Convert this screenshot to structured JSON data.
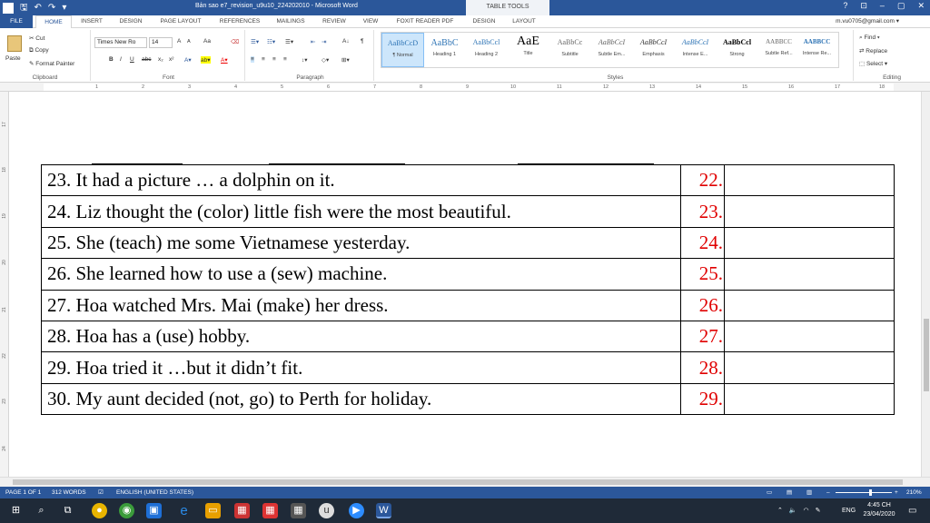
{
  "window": {
    "title": "Bản sao e7_revision_u9u10_224202010 - Microsoft Word",
    "table_tools": "TABLE TOOLS",
    "controls": [
      "?",
      "⊡",
      "–",
      "▢",
      "✕"
    ]
  },
  "tabs": {
    "file": "FILE",
    "home": "HOME",
    "insert": "INSERT",
    "design": "DESIGN",
    "page_layout": "PAGE LAYOUT",
    "references": "REFERENCES",
    "mailings": "MAILINGS",
    "review": "REVIEW",
    "view": "VIEW",
    "foxit": "FOXIT READER PDF",
    "tt_design": "DESIGN",
    "tt_layout": "LAYOUT",
    "account": "m.vu0705@gmail.com ▾"
  },
  "ribbon": {
    "clipboard": {
      "name": "Clipboard",
      "paste": "Paste",
      "cut": "Cut",
      "copy": "Copy",
      "format_painter": "Format Painter"
    },
    "font": {
      "name": "Font",
      "family": "Times New Ro",
      "size": "14",
      "grow": "A",
      "shrink": "A",
      "case": "Aa",
      "bold": "B",
      "italic": "I",
      "underline": "U",
      "strike": "abc",
      "sub": "x₂",
      "sup": "x²"
    },
    "paragraph": {
      "name": "Paragraph",
      "sort": "A↓",
      "pilcrow": "¶"
    },
    "styles": {
      "name": "Styles",
      "items": [
        {
          "preview": "AaBbCcD",
          "label": "¶ Normal"
        },
        {
          "preview": "AaBbC",
          "label": "Heading 1"
        },
        {
          "preview": "AaBbCcl",
          "label": "Heading 2"
        },
        {
          "preview": "AaE",
          "label": "Title"
        },
        {
          "preview": "AaBbCc",
          "label": "Subtitle"
        },
        {
          "preview": "AaBbCcI",
          "label": "Subtle Em..."
        },
        {
          "preview": "AaBbCcI",
          "label": "Emphasis"
        },
        {
          "preview": "AaBbCcI",
          "label": "Intense E..."
        },
        {
          "preview": "AaBbCcl",
          "label": "Strong"
        },
        {
          "preview": "AABBCC",
          "label": "Subtle Ref..."
        },
        {
          "preview": "AABBCC",
          "label": "Intense Re..."
        }
      ]
    },
    "editing": {
      "name": "Editing",
      "find": "Find ▾",
      "replace": "Replace",
      "select": "Select ▾"
    }
  },
  "ruler": {
    "marks": [
      "1",
      "2",
      "3",
      "4",
      "5",
      "6",
      "7",
      "8",
      "9",
      "10",
      "11",
      "12",
      "13",
      "14",
      "15",
      "16",
      "17",
      "18"
    ],
    "vmarks": [
      "17",
      "18",
      "19",
      "20",
      "21",
      "22",
      "23",
      "24"
    ]
  },
  "document": {
    "rows": [
      {
        "question": "23. It had a picture … a dolphin on it.",
        "answer": "22."
      },
      {
        "question": "24. Liz thought the (color) little fish were the most beautiful.",
        "answer": "23."
      },
      {
        "question": "25. She (teach) me some Vietnamese yesterday.",
        "answer": "24."
      },
      {
        "question": "26. She learned how to use a (sew) machine.",
        "answer": "25."
      },
      {
        "question": "27. Hoa watched Mrs. Mai (make) her dress.",
        "answer": "26."
      },
      {
        "question": "28. Hoa has a (use) hobby.",
        "answer": "27."
      },
      {
        "question": "29. Hoa tried it …but it didn’t fit.",
        "answer": "28."
      },
      {
        "question": "30. My aunt decided (not, go) to Perth for holiday.",
        "answer": "29."
      }
    ]
  },
  "statusbar": {
    "page": "PAGE 1 OF 1",
    "words": "312 WORDS",
    "language": "ENGLISH (UNITED STATES)",
    "zoom": "210%"
  },
  "taskbar": {
    "lang": "ENG",
    "time": "4:45 CH",
    "date": "23/04/2020"
  },
  "colors": {
    "word_blue": "#2b579a",
    "answer_red": "#e00000"
  }
}
